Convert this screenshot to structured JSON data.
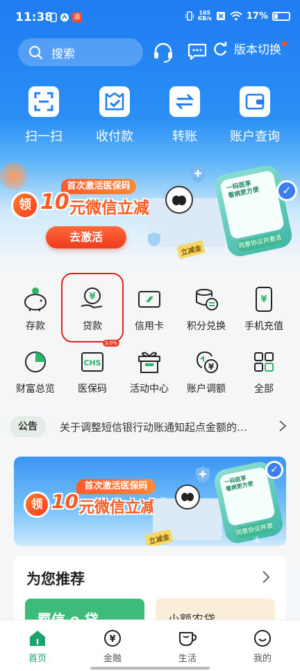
{
  "status": {
    "time": "11:38",
    "net_speed_top": "165",
    "net_speed_unit": "KB/s",
    "battery": "17%",
    "badge": "追"
  },
  "header": {
    "search_placeholder": "搜索",
    "version_switch": "版本切换"
  },
  "quick_actions": [
    {
      "label": "扫一扫",
      "icon": "scan-icon"
    },
    {
      "label": "收付款",
      "icon": "payment-icon"
    },
    {
      "label": "转账",
      "icon": "transfer-icon"
    },
    {
      "label": "账户查询",
      "icon": "wallet-icon"
    }
  ],
  "banner": {
    "tag": "首次激活医保码",
    "prefix": "领",
    "amount": "10",
    "headline": "元微信立减金",
    "cta": "去激活",
    "phone_button": "同意协议并激活",
    "phone_title": "一码医享\n看病更方便",
    "stamp": "立减金"
  },
  "menu": [
    {
      "label": "存款",
      "icon": "piggy-bank-icon"
    },
    {
      "label": "贷款",
      "icon": "loan-icon"
    },
    {
      "label": "信用卡",
      "icon": "credit-card-icon"
    },
    {
      "label": "积分兑换",
      "icon": "points-exchange-icon"
    },
    {
      "label": "手机充值",
      "icon": "phone-recharge-icon"
    },
    {
      "label": "财富总览",
      "icon": "wealth-chart-icon"
    },
    {
      "label": "医保码",
      "icon": "medical-insurance-icon"
    },
    {
      "label": "活动中心",
      "icon": "gift-icon"
    },
    {
      "label": "账户调额",
      "icon": "account-limit-icon"
    },
    {
      "label": "全部",
      "icon": "all-grid-icon"
    }
  ],
  "loan_badge": "3.0%",
  "notice": {
    "label": "公告",
    "text": "关于调整短信银行动账通知起点金额的…"
  },
  "recommend": {
    "title": "为您推荐",
    "card1": "羁信 e 贷",
    "card2": "小额农贷"
  },
  "nav": [
    {
      "label": "首页",
      "icon": "home-icon",
      "active": true
    },
    {
      "label": "金融",
      "icon": "finance-icon",
      "active": false
    },
    {
      "label": "生活",
      "icon": "life-cup-icon",
      "active": false
    },
    {
      "label": "我的",
      "icon": "profile-icon",
      "active": false
    }
  ],
  "colors": {
    "primary_blue": "#1f7cf2",
    "accent_green": "#1aa36a",
    "promo_orange": "#ff5a1f",
    "highlight_red": "#e02020"
  }
}
